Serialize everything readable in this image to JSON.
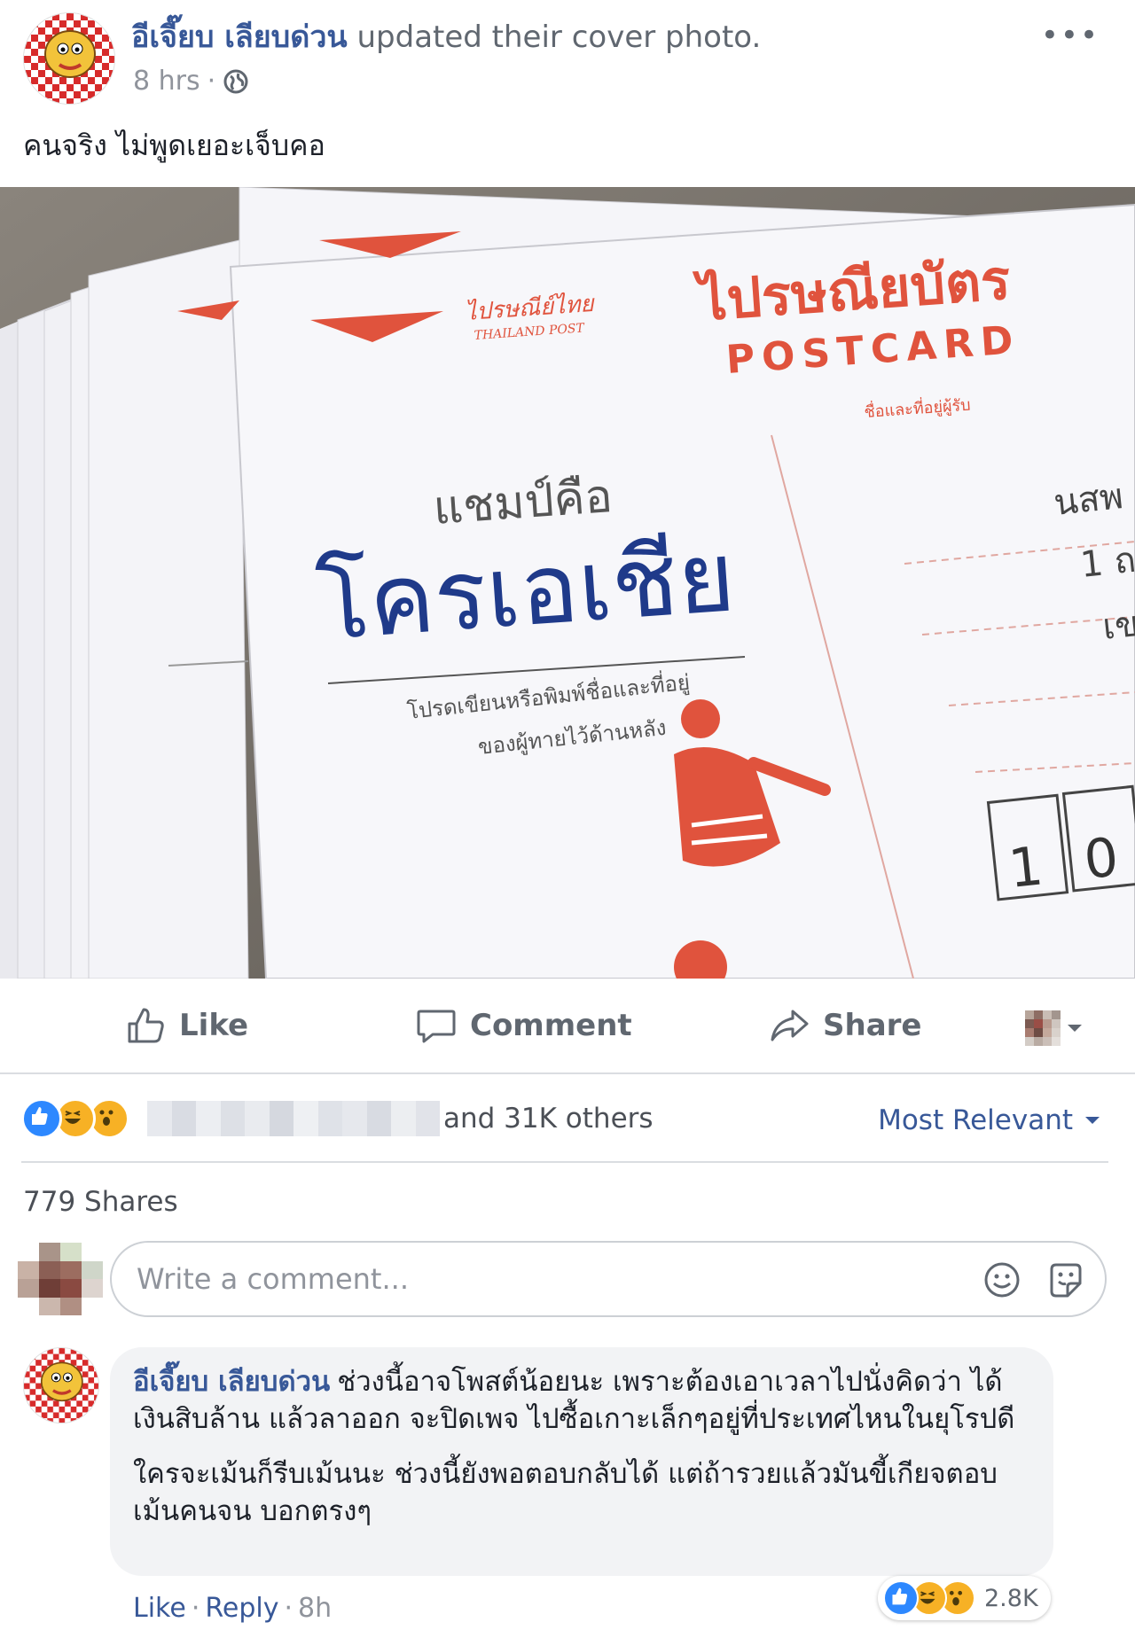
{
  "post": {
    "author": "อีเจี๊ยบ เลียบด่วน",
    "action": " updated their cover photo.",
    "time": "8 hrs",
    "time_sep": "·",
    "caption": "คนจริง ไม่พูดเยอะเจ็บคอ",
    "more_label": "•••"
  },
  "photo": {
    "brand_th": "ไปรษณีย์ไทย",
    "brand_en": "THAILAND POST",
    "title_th": "ไปรษณียบัตร",
    "title_en": "POSTCARD",
    "addressee_label": "ชื่อและที่อยู่ผู้รับ",
    "line1": "แชมป์คือ",
    "line2": "โครเอเชีย",
    "note1": "โปรดเขียนหรือพิมพ์ชื่อและที่อยู่",
    "note2": "ของผู้ทายไว้ด้านหลัง",
    "right1": "นสพ",
    "right2": "1 ถ",
    "right3": "เข",
    "box1": "1",
    "box2": "0"
  },
  "actions": {
    "like": "Like",
    "comment": "Comment",
    "share": "Share"
  },
  "reactions": {
    "others_text": "and 31K others",
    "sort_label": "Most Relevant",
    "shares_text": "779 Shares"
  },
  "composer": {
    "placeholder": "Write a comment..."
  },
  "comment": {
    "author": "อีเจี๊ยบ เลียบด่วน",
    "paragraph1": "ช่วงนี้อาจโพสต์น้อยนะ เพราะต้องเอาเวลาไปนั่งคิดว่า ได้เงินสิบล้าน แล้วลาออก จะปิดเพจ ไปซื้อเกาะเล็กๆอยู่ที่ประเทศไหนในยุโรปดี",
    "paragraph2": "ใครจะเม้นก็รีบเม้นนะ ช่วงนี้ยังพอตอบกลับได้ แต่ถ้ารวยแล้วมันขี้เกียจตอบเม้นคนจน บอกตรงๆ",
    "reaction_count": "2.8K",
    "like_label": "Like",
    "reply_label": "Reply",
    "sep": "·",
    "time": "8h"
  },
  "colors": {
    "link_blue": "#385898",
    "like_blue": "#2d88ff",
    "haha_yellow": "#f7b125",
    "postcard_red": "#e0533d",
    "ink_blue": "#1f3a8a"
  }
}
